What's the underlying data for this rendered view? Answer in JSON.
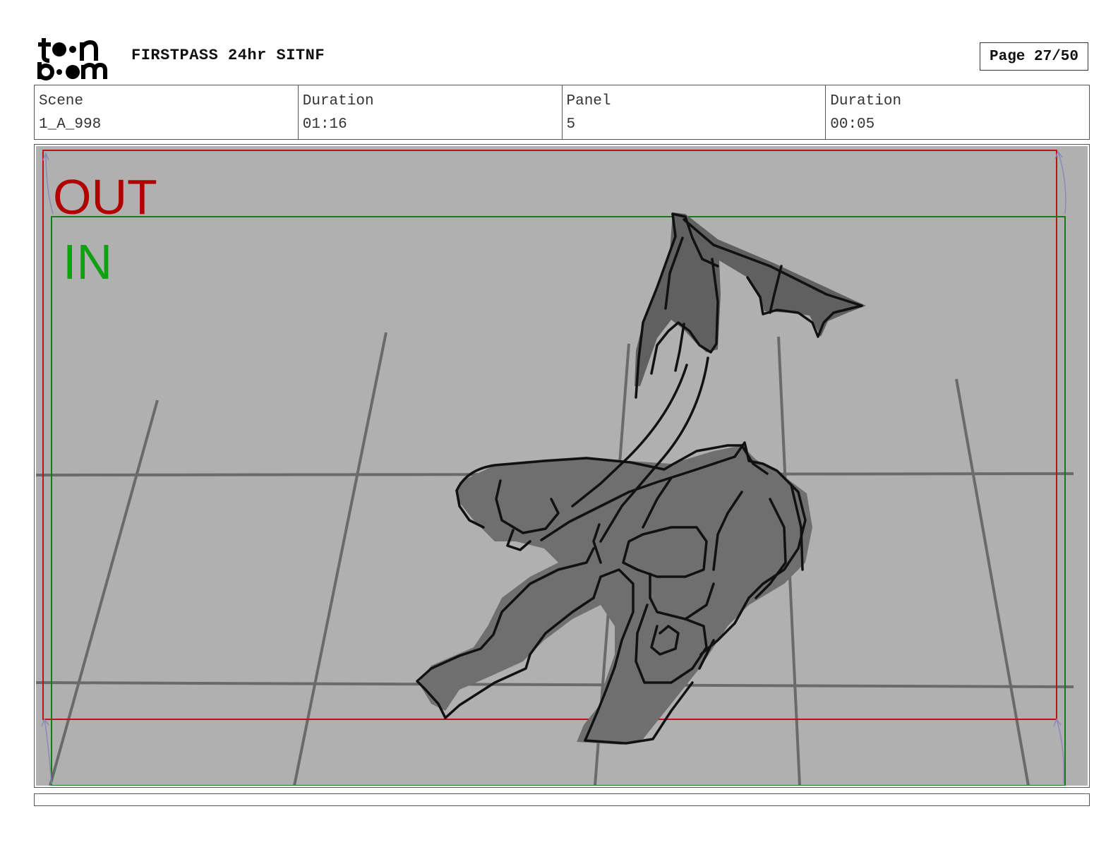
{
  "header": {
    "logo_text_top": "toon",
    "logo_text_bottom": "boom",
    "project_title": "FIRSTPASS 24hr SITNF",
    "page_label": "Page 27/50"
  },
  "info": {
    "scene_label": "Scene",
    "scene_value": "1_A_998",
    "scene_duration_label": "Duration",
    "scene_duration_value": "01:16",
    "panel_label": "Panel",
    "panel_value": "5",
    "panel_duration_label": "Duration",
    "panel_duration_value": "00:05"
  },
  "panel_frame": {
    "out_label": "OUT",
    "in_label": "IN",
    "out_color": "#b00000",
    "in_color": "#11a011",
    "background": "#b0b0b0",
    "drawing": "sketched dragon creature lying on tiled floor, viewed from above"
  }
}
